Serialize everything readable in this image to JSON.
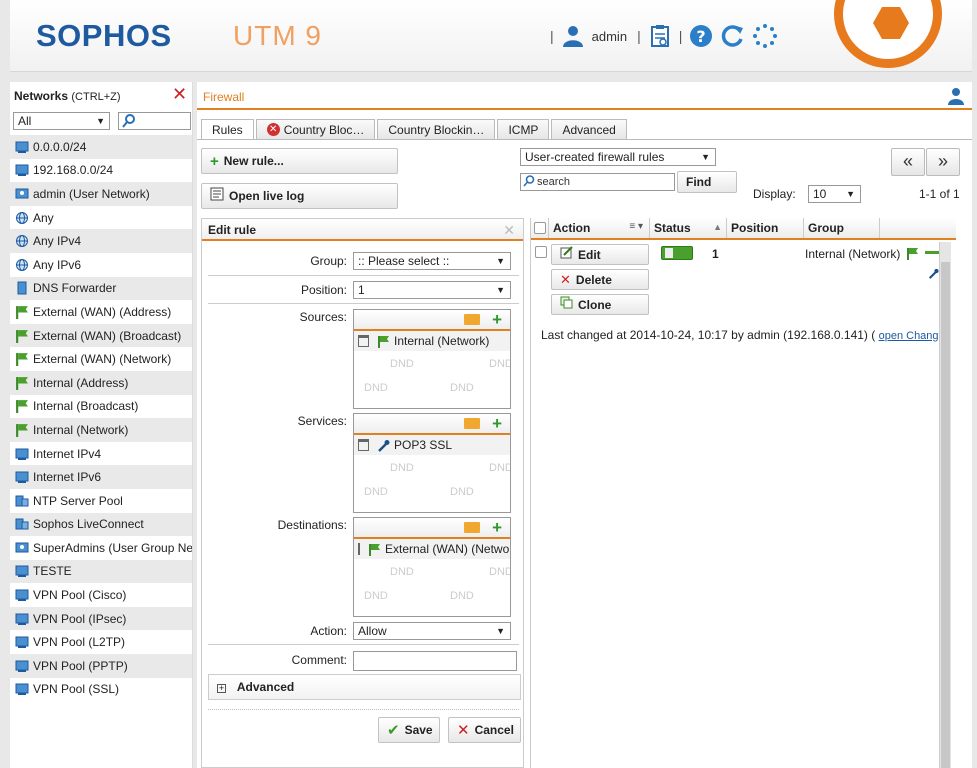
{
  "header": {
    "logo": "SOPHOS",
    "product": "UTM 9",
    "user": "admin",
    "colors": {
      "brand_blue": "#1e5aa0",
      "accent_orange": "#e87a1e"
    }
  },
  "network_panel": {
    "title": "Networks",
    "shortcut": "(CTRL+Z)",
    "filter_value": "All",
    "items": [
      {
        "label": "0.0.0.0/24",
        "icon": "network-icon"
      },
      {
        "label": "192.168.0.0/24",
        "icon": "network-icon"
      },
      {
        "label": "admin (User Network)",
        "icon": "user-network-icon"
      },
      {
        "label": "Any",
        "icon": "globe-icon"
      },
      {
        "label": "Any IPv4",
        "icon": "globe-icon"
      },
      {
        "label": "Any IPv6",
        "icon": "globe-icon"
      },
      {
        "label": "DNS Forwarder",
        "icon": "host-icon"
      },
      {
        "label": "External (WAN) (Address)",
        "icon": "interface-flag-icon"
      },
      {
        "label": "External (WAN) (Broadcast)",
        "icon": "interface-flag-icon"
      },
      {
        "label": "External (WAN) (Network)",
        "icon": "interface-flag-icon"
      },
      {
        "label": "Internal (Address)",
        "icon": "interface-flag-icon"
      },
      {
        "label": "Internal (Broadcast)",
        "icon": "interface-flag-icon"
      },
      {
        "label": "Internal (Network)",
        "icon": "interface-flag-icon"
      },
      {
        "label": "Internet IPv4",
        "icon": "network-icon"
      },
      {
        "label": "Internet IPv6",
        "icon": "network-icon"
      },
      {
        "label": "NTP Server Pool",
        "icon": "server-pool-icon"
      },
      {
        "label": "Sophos LiveConnect",
        "icon": "server-pool-icon"
      },
      {
        "label": "SuperAdmins (User Group Ne",
        "icon": "user-network-icon"
      },
      {
        "label": "TESTE",
        "icon": "network-icon"
      },
      {
        "label": "VPN Pool (Cisco)",
        "icon": "network-icon"
      },
      {
        "label": "VPN Pool (IPsec)",
        "icon": "network-icon"
      },
      {
        "label": "VPN Pool (L2TP)",
        "icon": "network-icon"
      },
      {
        "label": "VPN Pool (PPTP)",
        "icon": "network-icon"
      },
      {
        "label": "VPN Pool (SSL)",
        "icon": "network-icon"
      }
    ]
  },
  "main": {
    "breadcrumb": "Firewall",
    "tabs": [
      {
        "label": "Rules",
        "active": true
      },
      {
        "label": "Country Bloc…",
        "active": false,
        "error": true
      },
      {
        "label": "Country Blockin…",
        "active": false
      },
      {
        "label": "ICMP",
        "active": false
      },
      {
        "label": "Advanced",
        "active": false
      }
    ],
    "new_rule_label": "New rule...",
    "open_log_label": "Open live log",
    "rule_filter_value": "User-created firewall rules",
    "search_placeholder": "search",
    "find_label": "Find",
    "pager_prev": "«",
    "pager_next": "»",
    "display_label": "Display:",
    "display_value": "10",
    "page_info": "1-1 of 1"
  },
  "edit_rule": {
    "title": "Edit rule",
    "group_label": "Group:",
    "group_value": ":: Please select ::",
    "position_label": "Position:",
    "position_value": "1",
    "sources_label": "Sources:",
    "sources_entry": "Internal (Network)",
    "services_label": "Services:",
    "services_entry": "POP3 SSL",
    "destinations_label": "Destinations:",
    "destinations_entry": "External (WAN) (Network)",
    "dnd": "DND",
    "action_label": "Action:",
    "action_value": "Allow",
    "comment_label": "Comment:",
    "comment_value": "",
    "advanced_label": "Advanced",
    "save_label": "Save",
    "cancel_label": "Cancel"
  },
  "rules_table": {
    "columns": [
      "Action",
      "Status",
      "Position",
      "Group"
    ],
    "rows": [
      {
        "edit_label": "Edit",
        "delete_label": "Delete",
        "clone_label": "Clone",
        "status": "enabled",
        "position": "1",
        "group": "Internal (Network)"
      }
    ],
    "last_changed": "Last changed at 2014-10-24, 10:17 by admin (192.168.0.141) (",
    "open_changes_link": "open Changes"
  }
}
